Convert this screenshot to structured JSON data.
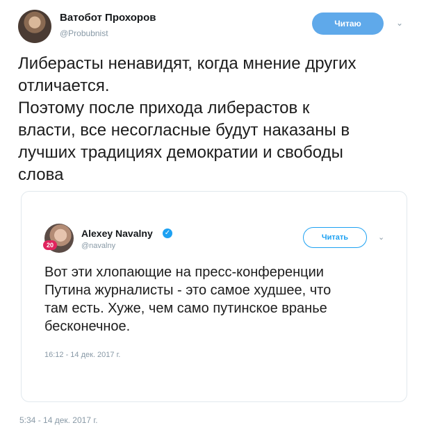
{
  "author": {
    "name": "Ватобот Прохоров",
    "handle": "@Probubnist",
    "follow_label": "Читаю",
    "menu_icon": "chevron-down-icon"
  },
  "tweet": {
    "lines": [
      "Либерасты ненавидят, когда мнение других",
      "отличается.",
      "Поэтому после прихода либерастов к",
      "власти, все несогласные будут наказаны в",
      "лучших традициях демократии и свободы",
      "слова"
    ],
    "timestamp": "5:34 - 14 дек. 2017 г."
  },
  "quoted": {
    "author_name": "Alexey Navalny",
    "verified_icon": "verified-badge-icon",
    "handle": "@navalny",
    "badge": "20",
    "follow_label": "Читать",
    "menu_icon": "chevron-down-icon",
    "lines": [
      "Вот эти хлопающие на пресс-конференции",
      "Путина журналисты - это самое худшее, что",
      "там есть. Хуже, чем само путинское вранье",
      "бесконечное."
    ],
    "timestamp": "16:12 - 14 дек. 2017 г."
  },
  "colors": {
    "follow_fill": "#5fa9ea",
    "link_blue": "#1da1f2",
    "muted": "#8899a6"
  }
}
